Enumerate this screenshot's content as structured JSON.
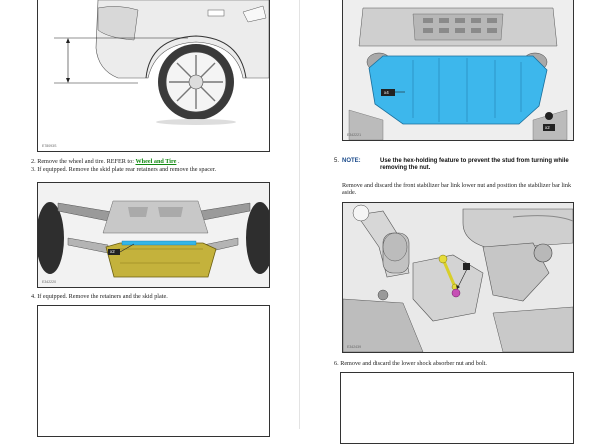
{
  "left_page": {
    "figure1_id": "E78093S",
    "step2": {
      "text": "2. Remove the wheel and tire. REFER to: ",
      "link": "Wheel and Tire",
      "suffix": " ."
    },
    "step3": "3. If equipped. Remove the skid plate rear retainers and remove the spacer.",
    "figure2_id": "E342220",
    "figure2_callout": "x2",
    "step4": "4. If equipped. Remove the retainers and the skid plate."
  },
  "right_page": {
    "figure1_id": "E342221",
    "figure1_callouts": [
      "x4",
      "x2"
    ],
    "step5_num": "5.",
    "note_label": "NOTE:",
    "note_text": "Use the hex-holding feature to prevent the stud from turning while removing the nut.",
    "step5_body": "Remove and discard the front stabilizer bar link lower nut and position the stabilizer bar link aside.",
    "figure2_id": "E342439",
    "step6": "6. Remove and discard the lower shock absorber nut and bolt."
  }
}
